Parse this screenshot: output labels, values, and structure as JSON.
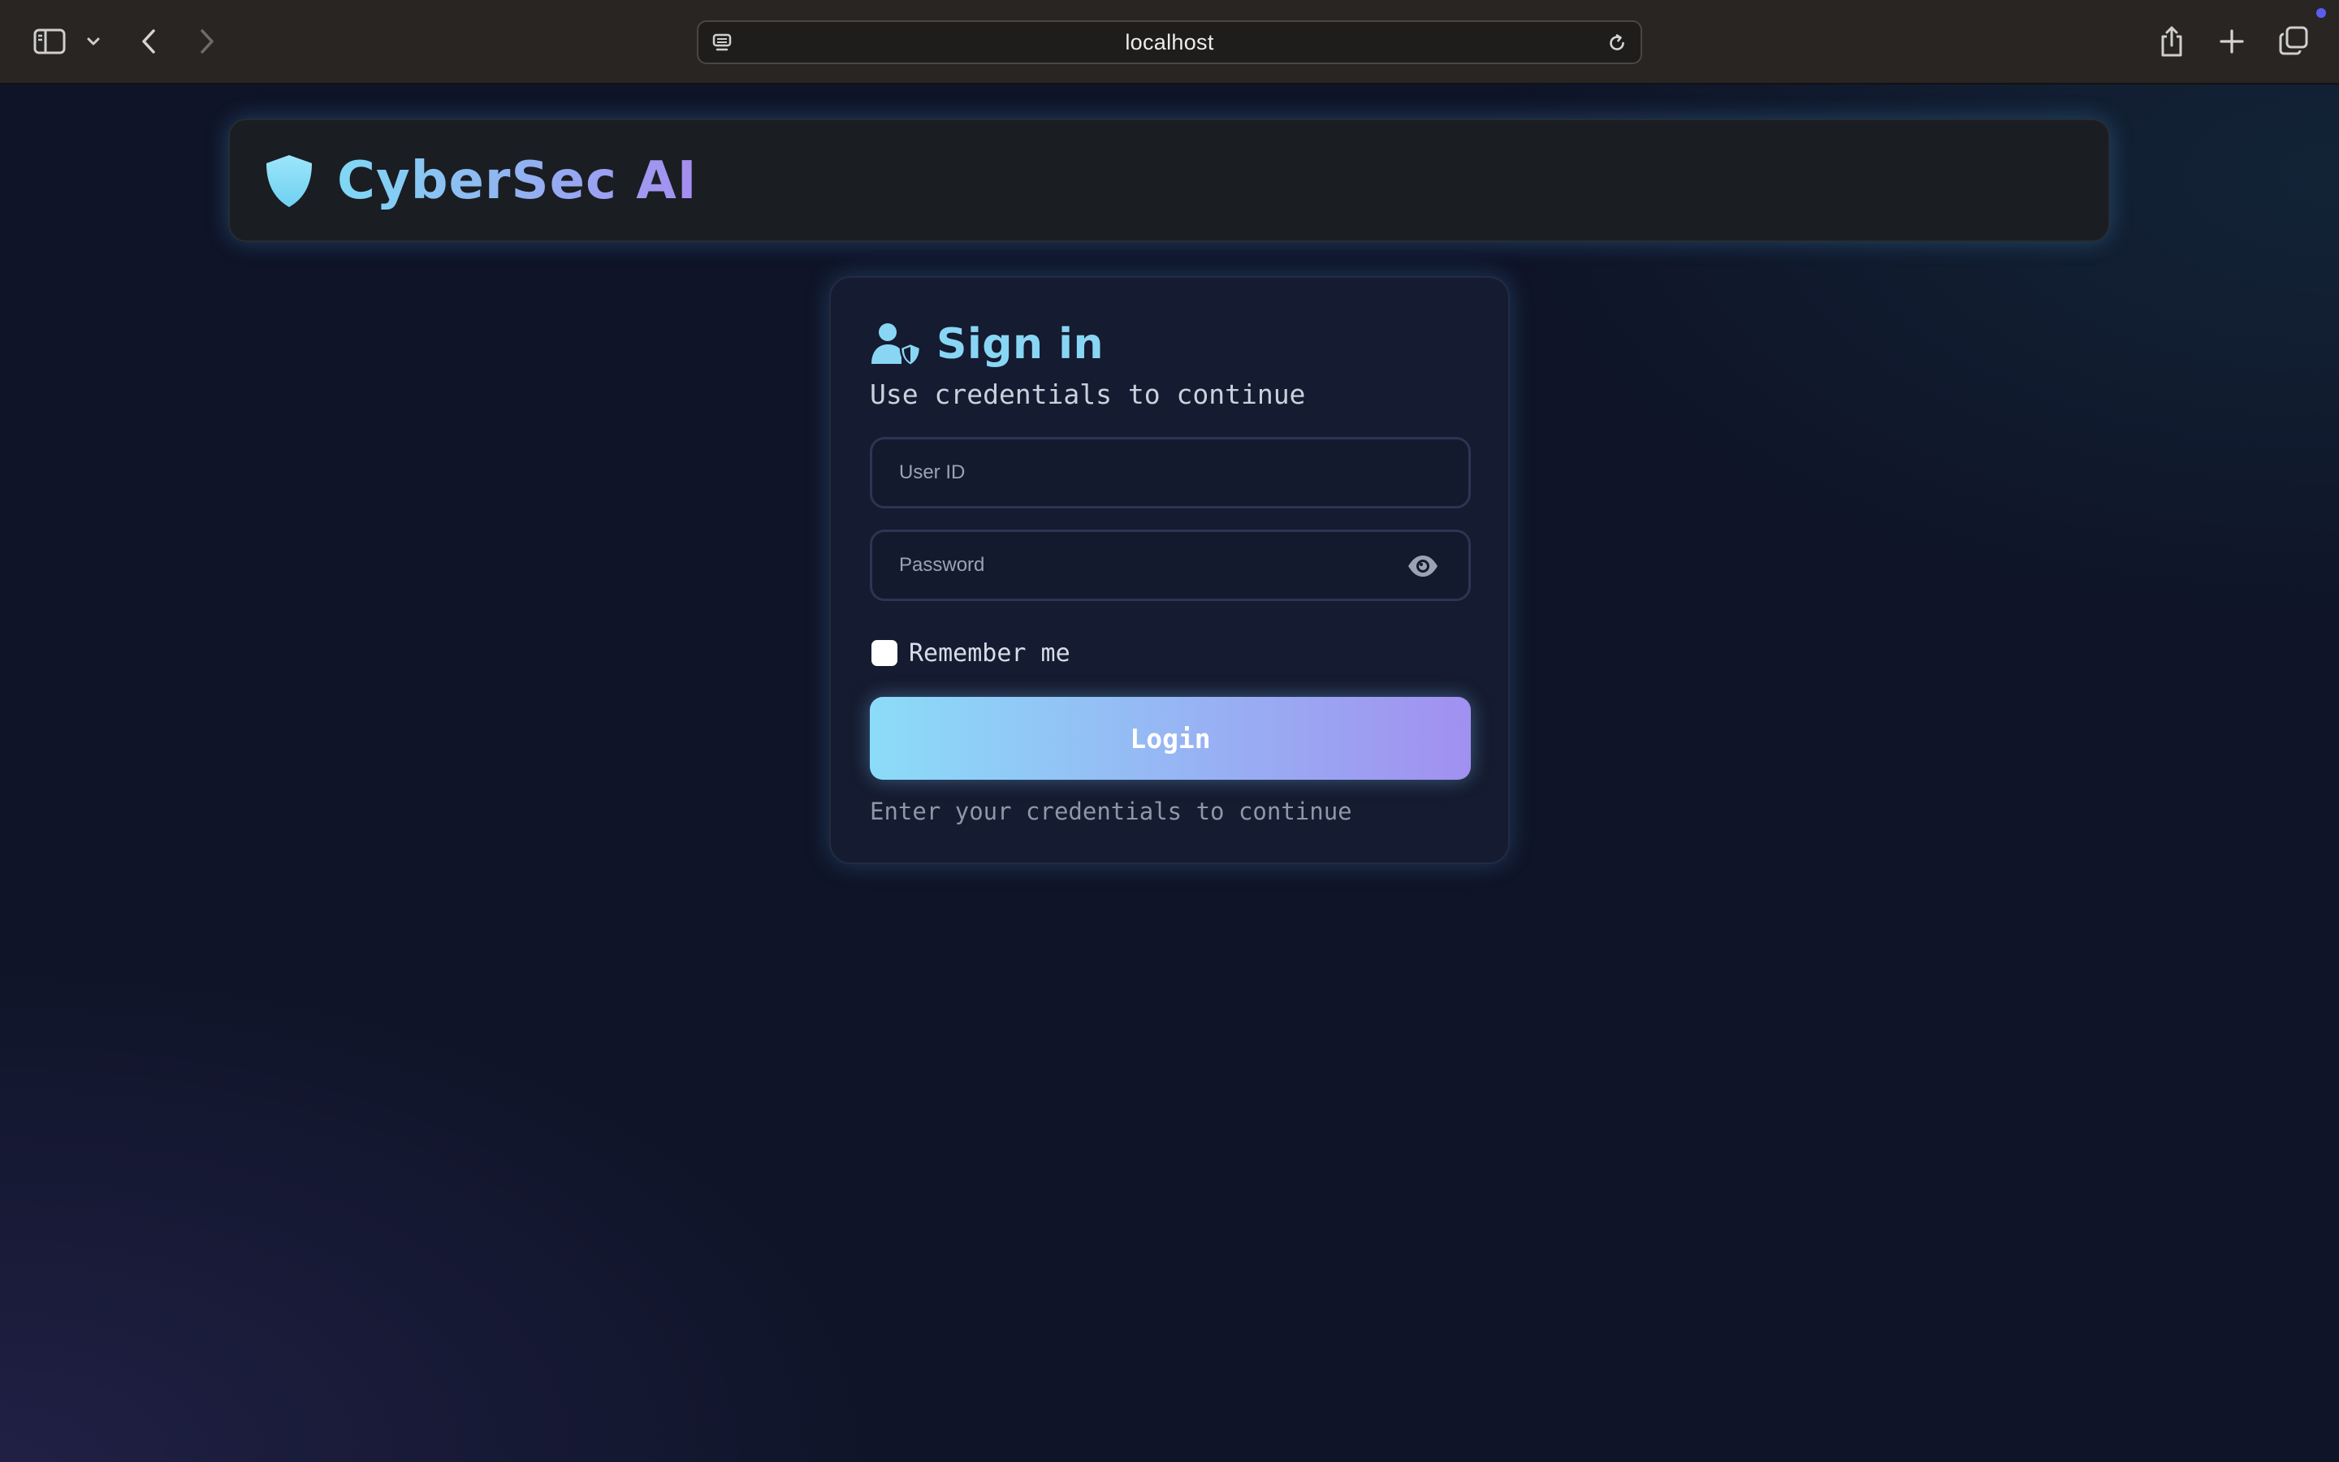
{
  "browser": {
    "address": "localhost",
    "icons": {
      "sidebar": "sidebar-icon",
      "dropdown": "chevron-down-icon",
      "back": "chevron-left-icon",
      "forward": "chevron-right-icon",
      "page_menu": "page-menu-icon",
      "reload": "reload-icon",
      "share": "share-icon",
      "new_tab": "plus-icon",
      "tabs": "tabs-overview-icon"
    }
  },
  "header": {
    "title": "CyberSec AI",
    "icon": "shield-icon"
  },
  "login": {
    "title": "Sign in",
    "title_icon": "user-shield-icon",
    "subtitle": "Use credentials to continue",
    "user_id": {
      "placeholder": "User ID",
      "value": ""
    },
    "password": {
      "placeholder": "Password",
      "value": "",
      "toggle_icon": "eye-icon"
    },
    "remember_label": "Remember me",
    "remember_checked": false,
    "button_label": "Login",
    "hint": "Enter your credentials to continue"
  },
  "colors": {
    "accent_cyan": "#88d6f4",
    "accent_purple": "#a190f0",
    "background": "#0f1428",
    "card": "#151b30",
    "chrome": "#282523",
    "notification_dot": "#5b5df2"
  }
}
